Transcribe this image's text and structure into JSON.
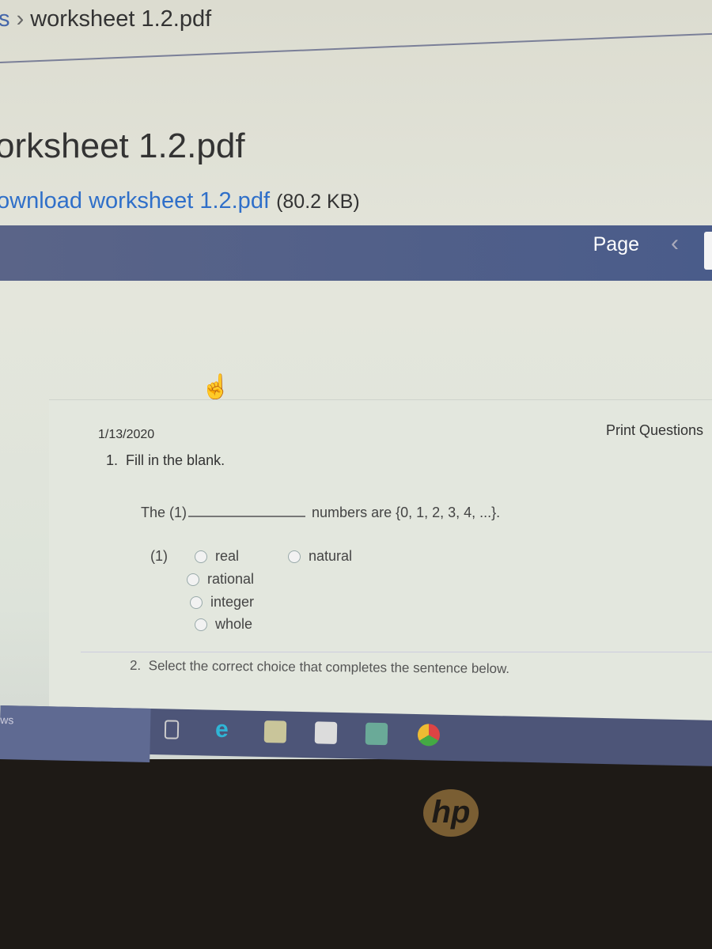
{
  "breadcrumb": {
    "prev": "s",
    "current": "worksheet 1.2.pdf"
  },
  "page_title": "orksheet 1.2.pdf",
  "download": {
    "link": "ownload worksheet 1.2.pdf",
    "size": "(80.2 KB)"
  },
  "toolbar": {
    "page_label": "Page"
  },
  "doc": {
    "date": "1/13/2020",
    "print_label": "Print Questions",
    "q1": {
      "number": "1.",
      "prompt": "Fill in the blank.",
      "sentence_start": "The (1)",
      "sentence_end": "numbers are {0, 1, 2, 3, 4, ...}.",
      "blank_label": "(1)",
      "options": [
        "real",
        "natural",
        "rational",
        "integer",
        "whole"
      ]
    },
    "q2": {
      "number": "2.",
      "prompt": "Select the correct choice that completes the sentence below."
    }
  },
  "taskbar": {
    "search_text": "ws",
    "icons": [
      "task-view",
      "edge",
      "file-explorer",
      "store",
      "tripadvisor",
      "chrome"
    ]
  },
  "logo": "hp"
}
